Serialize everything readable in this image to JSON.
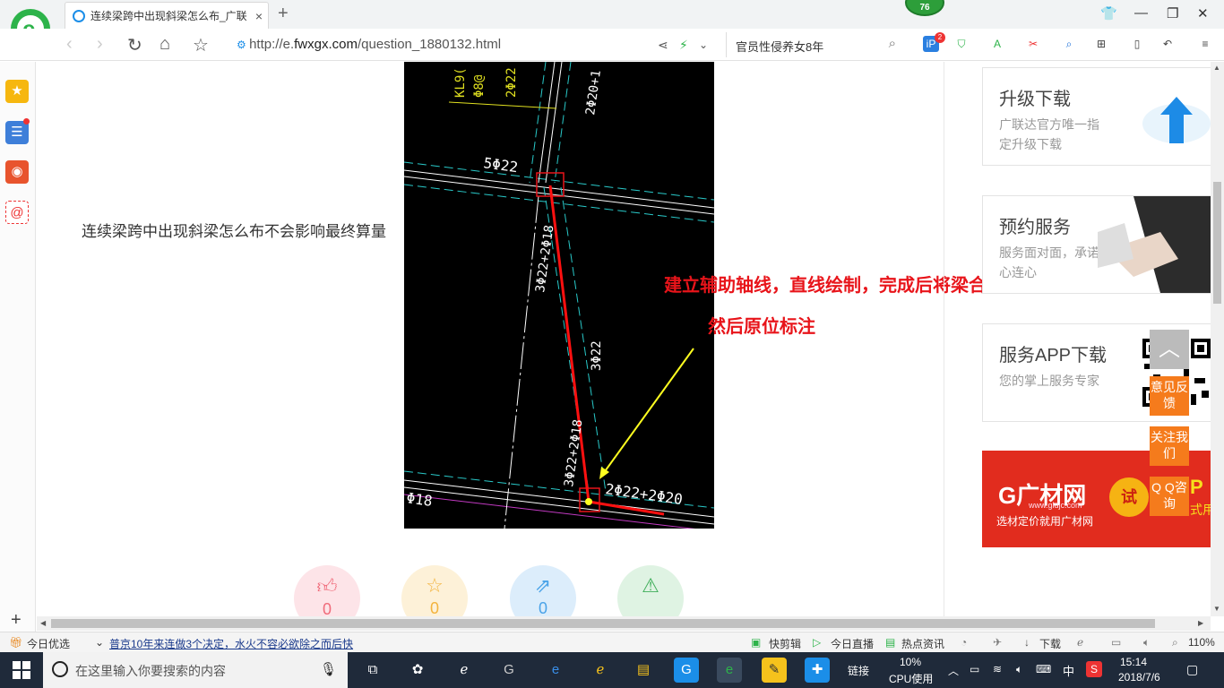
{
  "browser": {
    "tab_title": "连续梁跨中出现斜梁怎么布_广联",
    "tab_close": "×",
    "new_tab": "+",
    "badge_count": "76",
    "url_prefix": "http://e.",
    "url_domain": "fwxgx.com",
    "url_path": "/question_1880132.html",
    "search_text": "官员性侵养女8年",
    "toolbar_badge": "2"
  },
  "page": {
    "question_text": "连续梁跨中出现斜梁怎么布不会影响最终算量",
    "annotation_line1": "建立辅助轴线，直线绘制，完成后将梁合并",
    "annotation_line2": "然后原位标注",
    "cad_labels": {
      "kl": "KL9(",
      "stirrup": "Φ8@",
      "top_bars": "2Φ22",
      "vertical_right": "2Φ20+1",
      "five": "5Φ22",
      "left_diag": "3Φ22+2Φ18",
      "mid_diag": "3Φ22",
      "lower_diag": "3Φ22+2Φ18",
      "bottom": "2Φ22+2Φ20",
      "left_edge": "Φ18"
    },
    "actions": [
      {
        "icon": "thumb-up",
        "count": "0",
        "color": "#f06b7a",
        "bg": "#fde4e8"
      },
      {
        "icon": "star",
        "count": "0",
        "color": "#f3b33d",
        "bg": "#fdf1d8"
      },
      {
        "icon": "share",
        "count": "0",
        "color": "#4aa3e8",
        "bg": "#dcedfb"
      },
      {
        "icon": "warning",
        "count": "",
        "color": "#3fae5a",
        "bg": "#dff3e3"
      }
    ]
  },
  "sidebar_right": {
    "upgrade": {
      "title": "升级下载",
      "desc": "广联达官方唯一指定升级下载"
    },
    "booking": {
      "title": "预约服务",
      "desc": "服务面对面，承诺心连心"
    },
    "app": {
      "title": "服务APP下载",
      "desc": "您的掌上服务专家"
    },
    "ad": {
      "brand": "G广材网",
      "site": "www.gldjc.com",
      "slogan": "选材定价就用广材网",
      "try": "试",
      "side": "P",
      "side2": "式用"
    },
    "float_feedback": "意见反馈",
    "float_follow": "关注我们",
    "float_qq": "Q Q咨询",
    "to_top": "︿"
  },
  "statusbar": {
    "today": "今日优选",
    "news": "普京10年来连做3个决定，水火不容必欲除之而后快",
    "kuaijianji": "快剪辑",
    "live": "今日直播",
    "hot": "热点资讯",
    "download": "下载",
    "zoom": "110%"
  },
  "taskbar": {
    "search_placeholder": "在这里输入你要搜索的内容",
    "links": "链接",
    "cpu_percent": "10%",
    "cpu_label": "CPU使用",
    "ime": "中",
    "time": "15:14",
    "date": "2018/7/6"
  }
}
